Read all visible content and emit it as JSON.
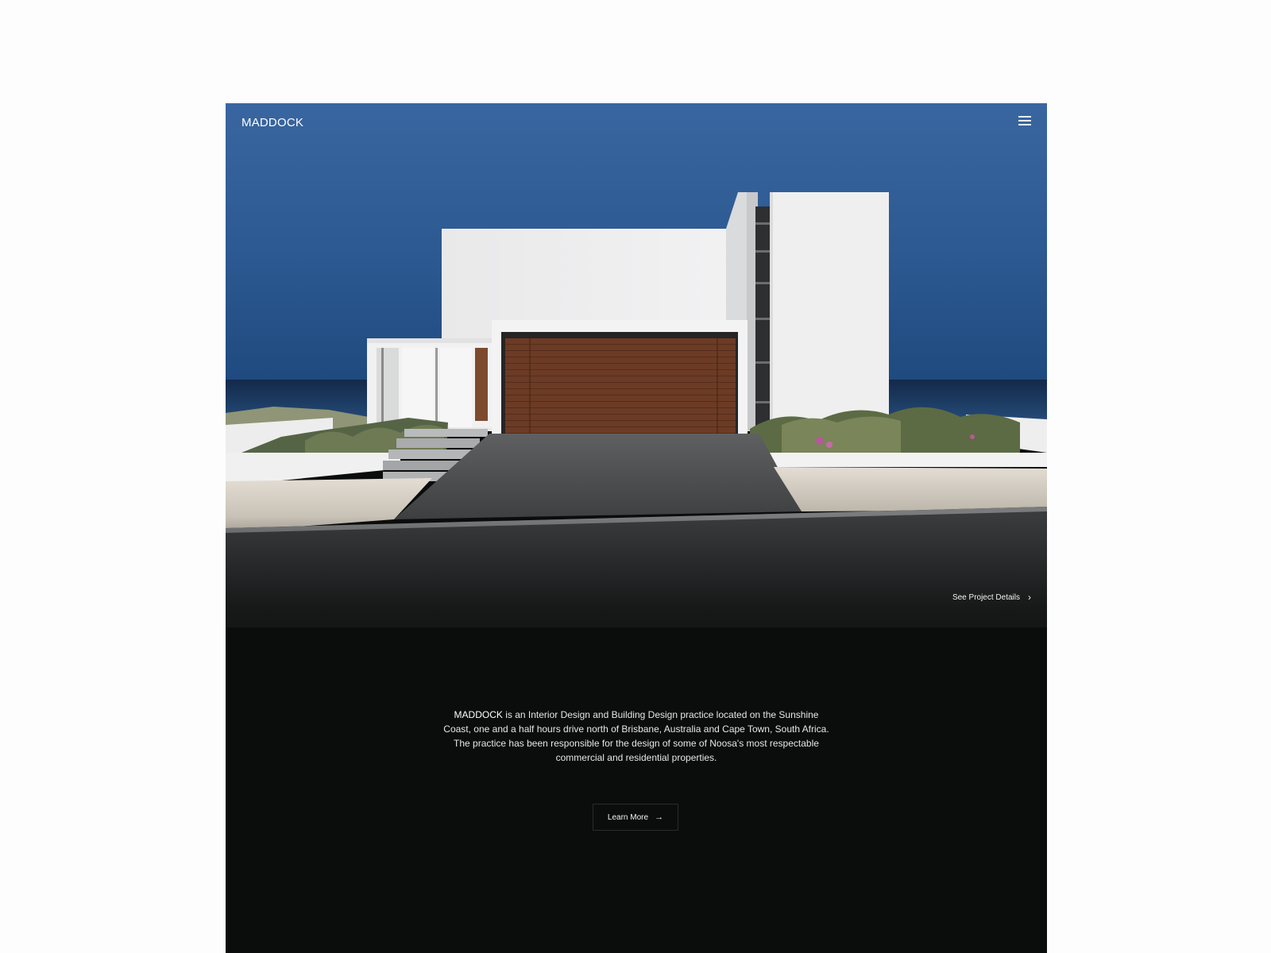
{
  "header": {
    "logo": "MADDOCK",
    "menu_icon": "hamburger-menu-icon"
  },
  "hero": {
    "image_subject": "white modern house with timber garage door by the ocean",
    "project_link_label": "See Project Details",
    "project_link_icon": "chevron-right-icon"
  },
  "about": {
    "brand": "MADDOCK",
    "text": " is an Interior Design and Building Design practice located on the Sunshine Coast, one and a half hours drive north of Brisbane, Australia and Cape Town, South Africa. The practice has been responsible for the design of some of Noosa's most respectable commercial and residential properties."
  },
  "cta": {
    "label": "Learn More",
    "icon": "arrow-right-icon"
  },
  "colors": {
    "page_bg": "#fdfdfd",
    "dark_bg": "#0b0c0c",
    "sky": "#2e5a92",
    "wall": "#eeeeee",
    "timber": "#6b3a24"
  }
}
